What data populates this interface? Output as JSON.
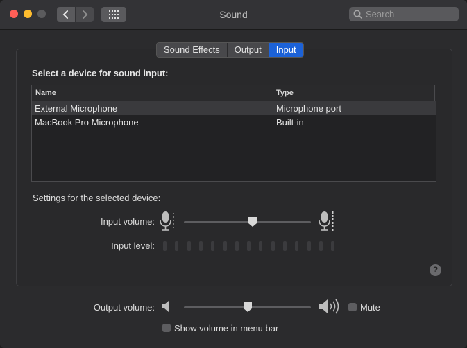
{
  "window": {
    "title": "Sound"
  },
  "search": {
    "placeholder": "Search"
  },
  "tabs": [
    {
      "label": "Sound Effects",
      "active": false
    },
    {
      "label": "Output",
      "active": false
    },
    {
      "label": "Input",
      "active": true
    }
  ],
  "input_pane": {
    "heading": "Select a device for sound input:",
    "columns": [
      "Name",
      "Type"
    ],
    "devices": [
      {
        "name": "External Microphone",
        "type": "Microphone port",
        "selected": true
      },
      {
        "name": "MacBook Pro Microphone",
        "type": "Built-in",
        "selected": false
      }
    ],
    "settings_label": "Settings for the selected device:",
    "input_volume_label": "Input volume:",
    "input_volume_value": 0.54,
    "input_level_label": "Input level:",
    "input_level_segments": 15,
    "input_level_value": 0,
    "help_label": "?"
  },
  "footer": {
    "output_volume_label": "Output volume:",
    "output_volume_value": 0.5,
    "mute_label": "Mute",
    "mute_checked": false,
    "show_volume_label": "Show volume in menu bar",
    "show_volume_checked": false
  },
  "colors": {
    "accent": "#1c62d8",
    "background": "#2b2b2d"
  },
  "icons": [
    "close-icon",
    "minimize-icon",
    "zoom-icon",
    "chevron-left-icon",
    "chevron-right-icon",
    "grid-icon",
    "search-icon",
    "microphone-low-icon",
    "microphone-high-icon",
    "speaker-low-icon",
    "speaker-high-icon",
    "help-icon"
  ]
}
